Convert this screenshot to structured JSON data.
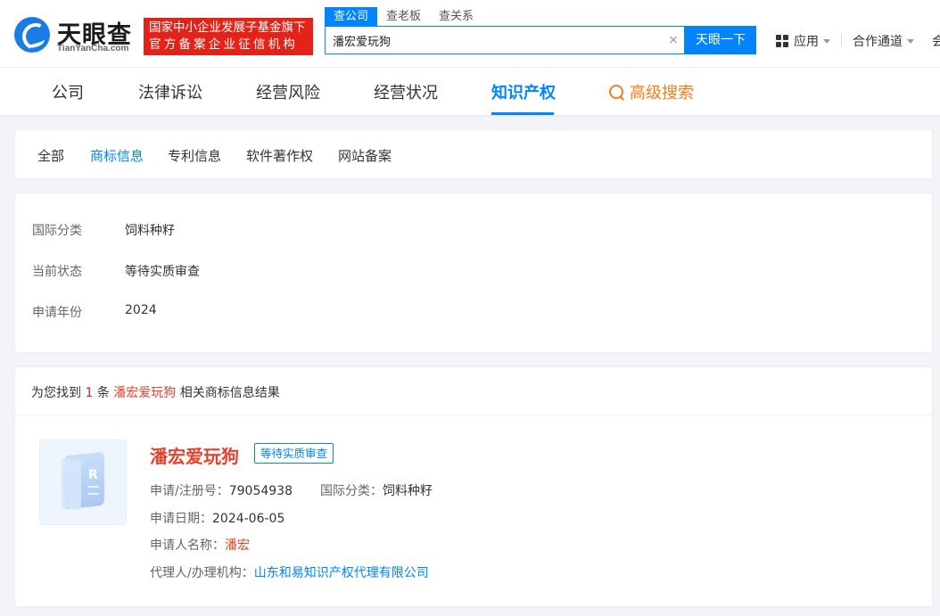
{
  "header": {
    "brand_cn": "天眼查",
    "brand_en": "TianYanCha.com",
    "gov_line1": "国家中小企业发展子基金旗下",
    "gov_line2": "官方备案企业征信机构",
    "search_tabs": [
      "查公司",
      "查老板",
      "查关系"
    ],
    "search_value": "潘宏爱玩狗",
    "clear_label": "×",
    "search_button": "天眼一下",
    "apps_label": "应用",
    "partner_label": "合作通道",
    "cut_label": "会"
  },
  "nav": {
    "items": [
      "公司",
      "法律诉讼",
      "经营风险",
      "经营状况",
      "知识产权"
    ],
    "advanced": "高级搜索",
    "active_index": 4
  },
  "subtabs": {
    "items": [
      "全部",
      "商标信息",
      "专利信息",
      "软件著作权",
      "网站备案"
    ],
    "active_index": 1
  },
  "filters": [
    {
      "label": "国际分类",
      "value": "饲料种籽"
    },
    {
      "label": "当前状态",
      "value": "等待实质审查"
    },
    {
      "label": "申请年份",
      "value": "2024"
    }
  ],
  "results": {
    "prefix": "为您找到",
    "count": "1",
    "unit": "条",
    "keyword": "潘宏爱玩狗",
    "suffix": "相关商标信息结果"
  },
  "trademark": {
    "name": "潘宏爱玩狗",
    "status": "等待实质审查",
    "reg_label": "申请/注册号：",
    "reg_no": "79054938",
    "class_label": "国际分类：",
    "class_value": "饲料种籽",
    "date_label": "申请日期：",
    "date_value": "2024-06-05",
    "applicant_label": "申请人名称：",
    "applicant_value": "潘宏",
    "agent_label": "代理人/办理机构：",
    "agent_value": "山东和易知识产权代理有限公司"
  },
  "colors": {
    "accent": "#0084ff",
    "brand_red": "#e3231a",
    "highlight": "#e8412c",
    "advanced_search": "#ff7a18"
  }
}
